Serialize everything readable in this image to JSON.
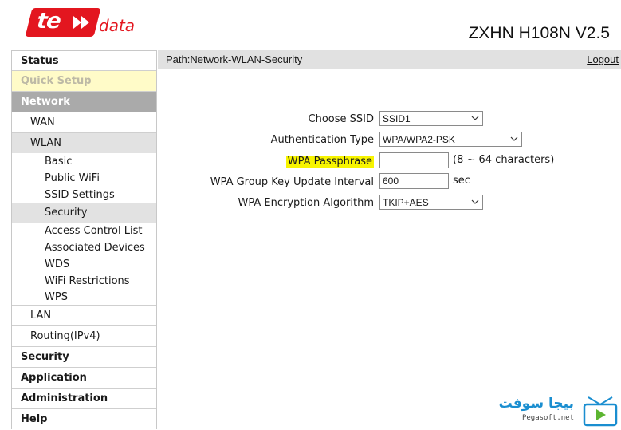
{
  "header": {
    "logo_text": "te",
    "logo_suffix": "data",
    "model": "ZXHN H108N V2.5"
  },
  "sidebar": {
    "items": [
      {
        "label": "Status"
      },
      {
        "label": "Quick Setup"
      },
      {
        "label": "Network"
      },
      {
        "label": "WAN"
      },
      {
        "label": "WLAN"
      },
      {
        "label": "Basic"
      },
      {
        "label": "Public WiFi"
      },
      {
        "label": "SSID Settings"
      },
      {
        "label": "Security",
        "selected": true
      },
      {
        "label": "Access Control List"
      },
      {
        "label": "Associated Devices"
      },
      {
        "label": "WDS"
      },
      {
        "label": "WiFi Restrictions"
      },
      {
        "label": "WPS"
      },
      {
        "label": "LAN"
      },
      {
        "label": "Routing(IPv4)"
      },
      {
        "label": "Security"
      },
      {
        "label": "Application"
      },
      {
        "label": "Administration"
      },
      {
        "label": "Help"
      }
    ]
  },
  "pathbar": {
    "path": "Path:Network-WLAN-Security",
    "logout": "Logout"
  },
  "form": {
    "ssid": {
      "label": "Choose SSID",
      "value": "SSID1"
    },
    "auth": {
      "label": "Authentication Type",
      "value": "WPA/WPA2-PSK"
    },
    "passphrase": {
      "label": "WPA Passphrase",
      "value": "",
      "hint": "(8 ~ 64 characters)",
      "highlight": "#f7f400"
    },
    "group_key": {
      "label": "WPA Group Key Update Interval",
      "value": "600",
      "unit": "sec"
    },
    "encryption": {
      "label": "WPA Encryption Algorithm",
      "value": "TKIP+AES"
    }
  },
  "watermark": {
    "text": "بيجا سوفت",
    "url": "Pegasoft.net"
  },
  "colors": {
    "brand_red": "#e3161f",
    "nav_active": "#aaaaaa",
    "quick_setup_bg": "#fffbc8",
    "pathbar_bg": "#e1e1e1"
  }
}
